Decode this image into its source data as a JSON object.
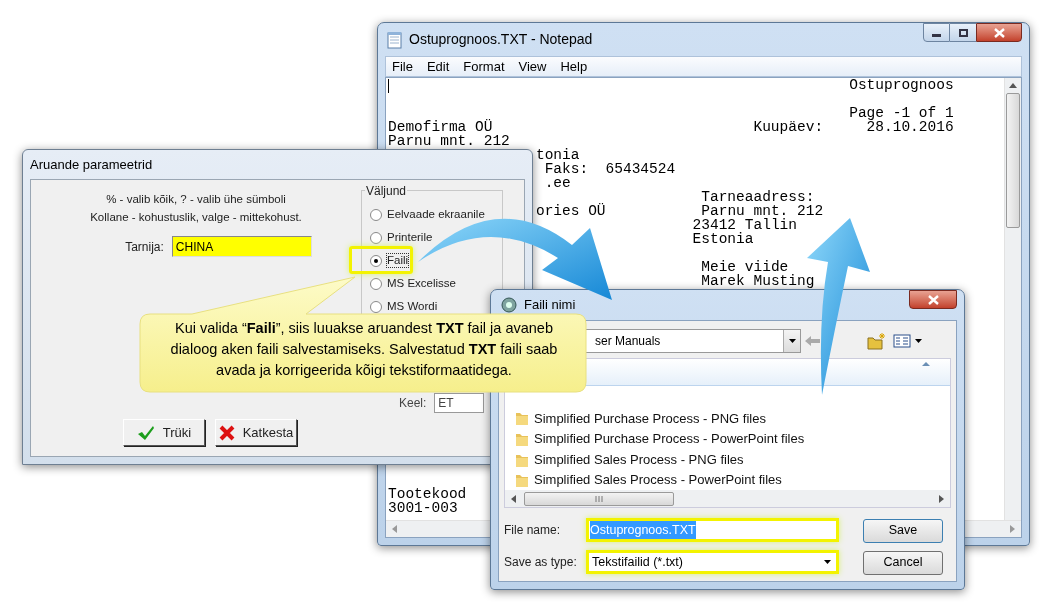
{
  "notepad": {
    "title": "Ostuprognoos.TXT - Notepad",
    "menu": [
      "File",
      "Edit",
      "Format",
      "View",
      "Help"
    ],
    "blocks": [
      [
        "                                                     Ostuprognoos"
      ],
      [
        "                                                     Page -1 of 1",
        "Demofirma OÜ                              Kuupäev:     28.10.2016",
        "Parnu mnt. 212",
        "                 tonia",
        "                  Faks:  65434524",
        "                  .ee",
        "                                    Tarneaadress:",
        "                 ories OÜ           Parnu mnt. 212",
        "                                   23412 Tallin",
        "                                   Estonia"
      ],
      [
        "                                    Meie viide",
        "                                    Marek Musting"
      ],
      [
        "Tootekood",
        "3001-003"
      ]
    ]
  },
  "report_dialog": {
    "title": "Aruande parameetrid",
    "hints": [
      "% - valib kõik, ? - valib ühe sümboli",
      "Kollane - kohustuslik, valge - mittekohust."
    ],
    "supplier": {
      "label": "Tarnija:",
      "value": "CHINA"
    },
    "output": {
      "label": "Väljund",
      "options": [
        {
          "label": "Eelvaade ekraanile",
          "selected": false
        },
        {
          "label": "Printerile",
          "selected": false
        },
        {
          "label": "Faili",
          "selected": true
        },
        {
          "label": "MS Excelisse",
          "selected": false
        },
        {
          "label": "MS Wordi",
          "selected": false
        }
      ]
    },
    "language": {
      "label": "Keel:",
      "value": "ET"
    },
    "buttons": [
      {
        "label": "Trüki",
        "kind": "ok"
      },
      {
        "label": "Katkesta",
        "kind": "cancel"
      }
    ]
  },
  "save_dialog": {
    "title": "Faili nimi",
    "folder": "ser Manuals",
    "items": [
      "Simplified Purchase Process - PNG files",
      "Simplified Purchase Process - PowerPoint files",
      "Simplified Sales Process - PNG files",
      "Simplified Sales Process - PowerPoint files"
    ],
    "file_name": {
      "label": "File name:",
      "value": "Ostuprognoos.TXT"
    },
    "save_as_type": {
      "label": "Save as type:",
      "value": "Tekstifailid (*.txt)"
    },
    "buttons": [
      "Save",
      "Cancel"
    ]
  },
  "callout": {
    "text": "Kui valida “**Faili**”, siis luuakse aruandest **TXT** fail ja avaneb dialoog aken faili salvestamiseks. Salvestatud **TXT** faili saab avada ja korrigeerida kõigi tekstiformaatidega."
  }
}
